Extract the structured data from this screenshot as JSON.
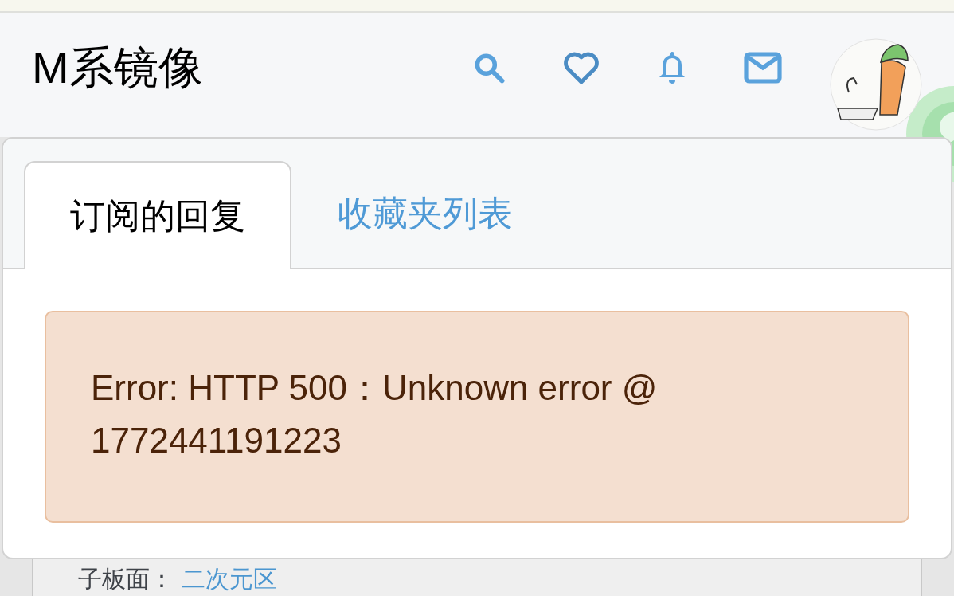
{
  "header": {
    "title": "M系镜像"
  },
  "tabs": [
    {
      "label": "订阅的回复",
      "selected": true
    },
    {
      "label": "收藏夹列表",
      "selected": false
    }
  ],
  "error": {
    "message": "Error: HTTP 500：Unknown error @ 1772441191223"
  },
  "background_card": {
    "label": "子板面：",
    "link": "二次元区"
  }
}
